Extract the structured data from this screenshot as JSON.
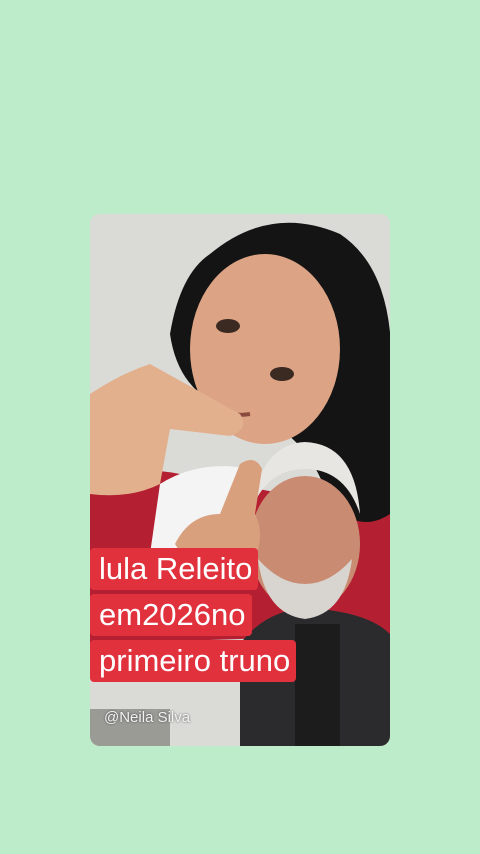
{
  "caption": {
    "lines": [
      "lula Releito",
      "em2026no",
      "primeiro truno"
    ]
  },
  "watermark": "@Neila Silva",
  "colors": {
    "background": "#bdeccb",
    "caption_bg": "#e0313d",
    "caption_text": "#ffffff"
  }
}
